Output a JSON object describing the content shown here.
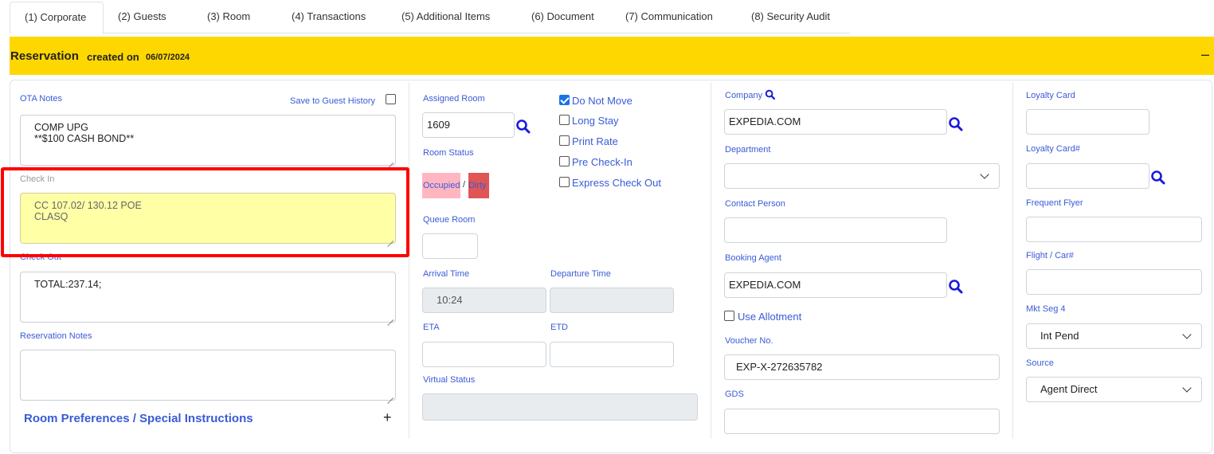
{
  "tabs": [
    {
      "label": "(1) Corporate",
      "active": true
    },
    {
      "label": "(2) Guests",
      "active": false
    },
    {
      "label": "(3) Room",
      "active": false
    },
    {
      "label": "(4) Transactions",
      "active": false
    },
    {
      "label": "(5) Additional Items",
      "active": false
    },
    {
      "label": "(6) Document",
      "active": false
    },
    {
      "label": "(7) Communication",
      "active": false
    },
    {
      "label": "(8) Security Audit",
      "active": false
    }
  ],
  "header": {
    "title": "Reservation",
    "created_on_label": "created on",
    "created_date": "06/07/2024",
    "collapse_icon": "–",
    "background": "#ffd700"
  },
  "notes": {
    "ota_label": "OTA Notes",
    "save_history_label": "Save to Guest History",
    "save_history_checked": false,
    "ota_lines": [
      "COMP UPG",
      "**$100 CASH BOND**"
    ],
    "checkin_label": "Check In",
    "checkin_lines": [
      "CC 107.02/ 130.12 POE",
      "CLASQ"
    ],
    "checkout_label": "Check Out",
    "checkout_lines": [
      "TOTAL:237.14;"
    ],
    "reservation_notes_label": "Reservation Notes",
    "reservation_notes_value": "",
    "room_preferences_label": "Room Preferences / Special Instructions",
    "room_preferences_toggle": "+"
  },
  "room": {
    "assigned_room_label": "Assigned Room",
    "assigned_room_value": "1609",
    "room_status_label": "Room Status",
    "status_occupied": "Occupied",
    "status_separator": "/",
    "status_dirty": "Dirty",
    "queue_room_label": "Queue Room",
    "queue_room_value": "",
    "arrival_time_label": "Arrival Time",
    "arrival_time_value": "10:24",
    "departure_time_label": "Departure Time",
    "departure_time_value": "",
    "eta_label": "ETA",
    "eta_value": "",
    "etd_label": "ETD",
    "etd_value": "",
    "virtual_status_label": "Virtual Status",
    "virtual_status_value": ""
  },
  "options": [
    {
      "label": "Do Not Move",
      "checked": true
    },
    {
      "label": "Long Stay",
      "checked": false
    },
    {
      "label": "Print Rate",
      "checked": false
    },
    {
      "label": "Pre Check-In",
      "checked": false
    },
    {
      "label": "Express Check Out",
      "checked": false
    }
  ],
  "company": {
    "company_label": "Company",
    "company_value": "EXPEDIA.COM",
    "department_label": "Department",
    "department_value": "",
    "contact_label": "Contact Person",
    "contact_value": "",
    "booking_agent_label": "Booking Agent",
    "booking_agent_value": "EXPEDIA.COM",
    "use_allotment_label": "Use Allotment",
    "use_allotment_checked": false,
    "voucher_label": "Voucher No.",
    "voucher_value": "EXP-X-272635782",
    "gds_label": "GDS",
    "gds_value": ""
  },
  "loyalty": {
    "loyalty_card_label": "Loyalty Card",
    "loyalty_card_value": "",
    "loyalty_card_no_label": "Loyalty Card#",
    "loyalty_card_no_value": "",
    "frequent_flyer_label": "Frequent Flyer",
    "frequent_flyer_value": "",
    "flight_car_label": "Flight / Car#",
    "flight_car_value": "",
    "mkt_seg_label": "Mkt Seg 4",
    "mkt_seg_value": "Int Pend",
    "source_label": "Source",
    "source_value": "Agent Direct"
  },
  "colors": {
    "label_blue": "#3a5bd6",
    "search_icon": "#1a1adb",
    "highlight_border": "#ff0000",
    "checkin_bg": "#ffffa6",
    "occupied_bg": "#ffb6c1",
    "dirty_bg": "#e05555"
  },
  "icons": {
    "search": "search-icon",
    "chevron": "chevron-down-icon",
    "collapse": "minus-icon",
    "expand": "plus-icon"
  }
}
